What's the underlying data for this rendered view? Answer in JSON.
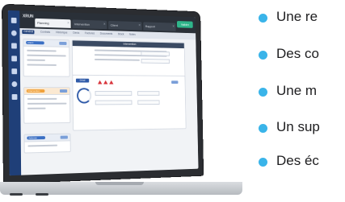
{
  "app": {
    "name": "XRUN",
    "tabs": [
      "Planning",
      "Intervention",
      "Client",
      "Rapport"
    ],
    "action_button": "Valider",
    "nav_items": [
      "Général",
      "Contrats",
      "Historique",
      "Devis",
      "Factures",
      "Documents",
      "Stock",
      "Notes"
    ],
    "panel_titles": [
      "Client",
      "Intervention",
      "Adresse",
      "Synthèse"
    ],
    "center_title": "Intervention",
    "gauge_button": "Détail"
  },
  "feature_list": {
    "bullet_color": "#3ab4e9",
    "items": [
      "Une re",
      "Des co",
      "Une m",
      "Un sup",
      "Des éc"
    ]
  }
}
